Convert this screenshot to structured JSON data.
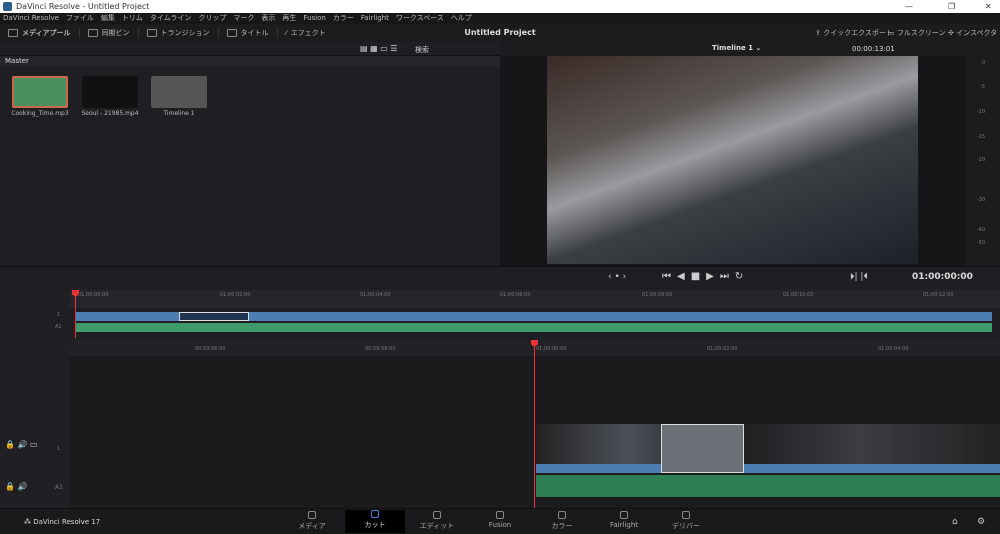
{
  "window": {
    "title": "DaVinci Resolve - Untitled Project"
  },
  "menu": [
    "DaVinci Resolve",
    "ファイル",
    "編集",
    "トリム",
    "タイムライン",
    "クリップ",
    "マーク",
    "表示",
    "再生",
    "Fusion",
    "カラー",
    "Fairlight",
    "ワークスペース",
    "ヘルプ"
  ],
  "toolbar": {
    "media_pool": "メディアプール",
    "sync_bin": "同期ビン",
    "transitions": "トランジション",
    "titles": "タイトル",
    "effects": "エフェクト",
    "project_title": "Untitled Project",
    "quick_export": "クイックエクスポート",
    "fullscreen": "フルスクリーン",
    "inspector": "インスペクタ"
  },
  "bin": {
    "search": "検索",
    "master": "Master",
    "clips": [
      {
        "name": "Cooking_Time.mp3"
      },
      {
        "name": "Seoul - 21985.mp4"
      },
      {
        "name": "Timeline 1"
      }
    ]
  },
  "viewer": {
    "timeline_name": "Timeline 1 ⌄",
    "duration": "00:00:13:01",
    "timecode": "01:00:00:00"
  },
  "meter": [
    "0",
    "-5",
    "-10",
    "-15",
    "-20",
    "-30",
    "-40",
    "-50"
  ],
  "ruler_top": [
    "01:00:00:00",
    "01:00:02:00",
    "01:00:04:00",
    "01:00:06:00",
    "01:00:08:00",
    "01:00:10:00",
    "01:00:12:00"
  ],
  "ruler_bottom": [
    "00:59:56:00",
    "00:59:58:00",
    "01:00:00:00",
    "01:00:02:00",
    "01:00:04:00"
  ],
  "tracks": {
    "v1": "1",
    "a1": "A1"
  },
  "footer": {
    "app": "DaVinci Resolve 17",
    "pages": [
      "メディア",
      "カット",
      "エディット",
      "Fusion",
      "カラー",
      "Fairlight",
      "デリバー"
    ]
  }
}
